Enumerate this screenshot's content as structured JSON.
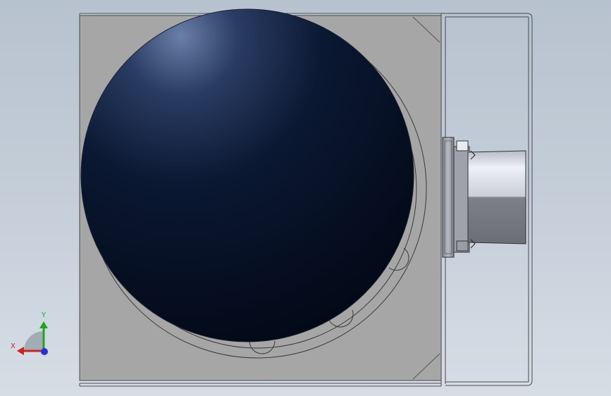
{
  "viewport": {
    "background_top": "#b7c2cf",
    "background_bottom": "#d6dde5"
  },
  "model": {
    "plate_color": "#a5a5a5",
    "sphere_color_dark": "#030d1f",
    "sphere_color_light": "#5a6f99",
    "edge_color": "#3a3a3a",
    "connector_color": "#8d8f96",
    "connector_highlight": "#e6e9f0"
  },
  "triad": {
    "x_label": "X",
    "y_label": "Y",
    "x_color": "#cc2222",
    "y_color": "#22a322",
    "z_color": "#2233cc"
  }
}
